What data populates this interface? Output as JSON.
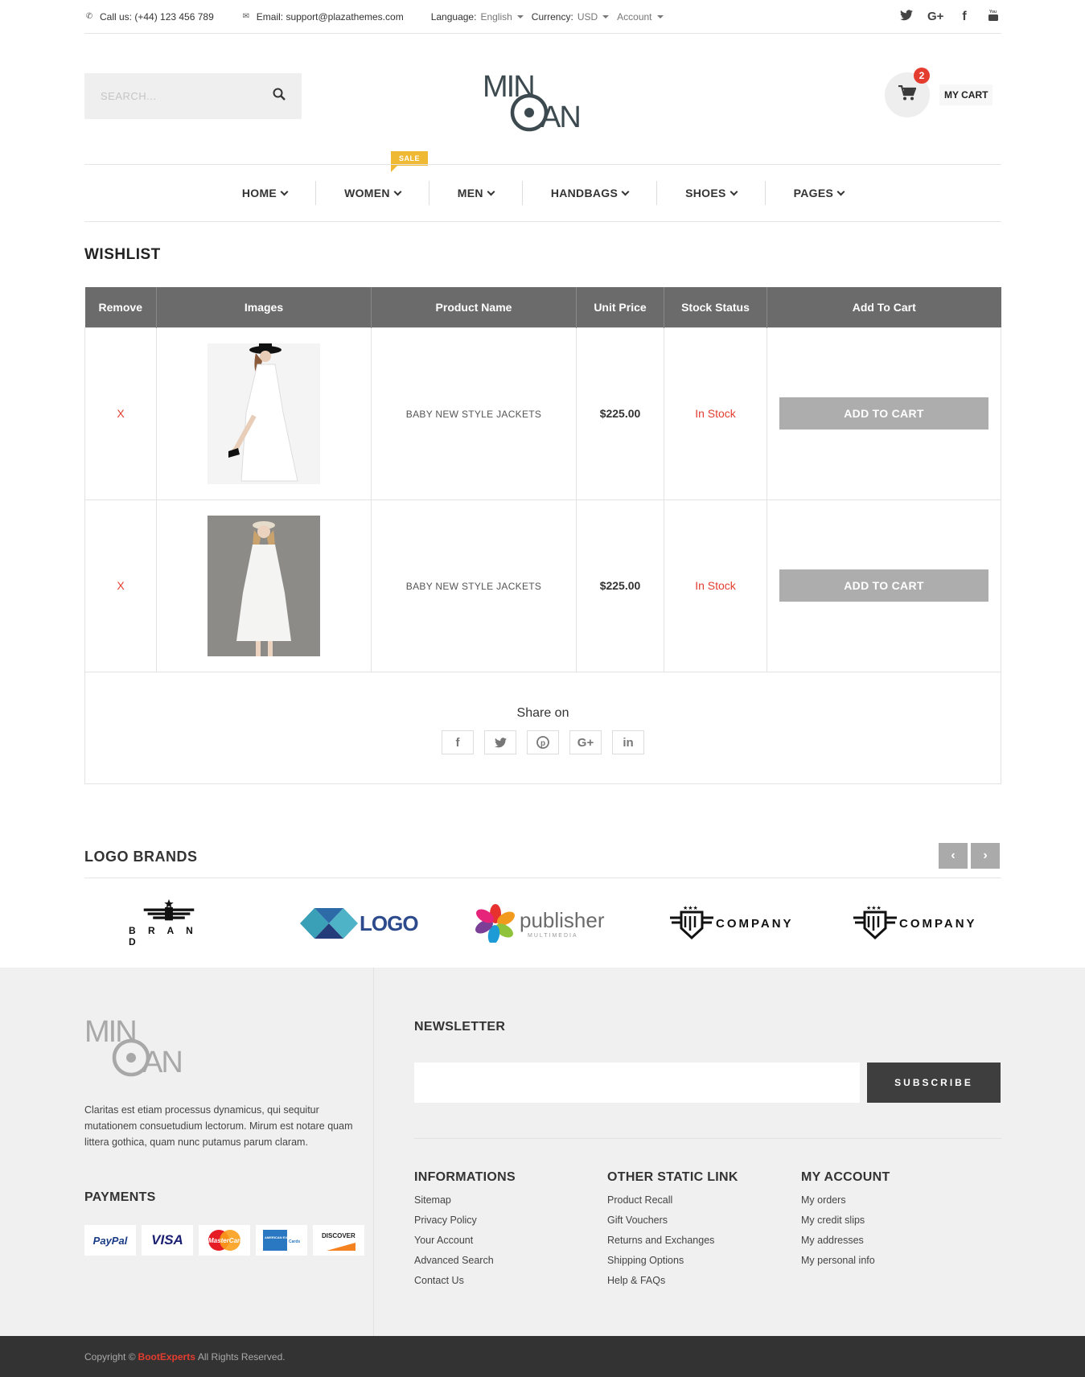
{
  "topbar": {
    "phone": "Call us: (+44) 123 456 789",
    "email": "Email: support@plazathemes.com",
    "language_label": "Language:",
    "language_value": "English",
    "currency_label": "Currency:",
    "currency_value": "USD",
    "account": "Account",
    "social": [
      "twitter-icon",
      "google-plus-icon",
      "facebook-icon",
      "youtube-icon"
    ]
  },
  "header": {
    "search_placeholder": "SEARCH...",
    "logo_top": "MIN",
    "logo_bottom": "AN",
    "cart_count": "2",
    "cart_label": "MY CART"
  },
  "nav": {
    "items": [
      {
        "label": "HOME"
      },
      {
        "label": "WOMEN"
      },
      {
        "label": "MEN"
      },
      {
        "label": "HANDBAGS"
      },
      {
        "label": "SHOES"
      },
      {
        "label": "PAGES"
      }
    ],
    "sale_badge": "SALE"
  },
  "wishlist": {
    "title": "WISHLIST",
    "columns": [
      "Remove",
      "Images",
      "Product Name",
      "Unit Price",
      "Stock Status",
      "Add To Cart"
    ],
    "rows": [
      {
        "remove": "X",
        "name": "BABY NEW STYLE JACKETS",
        "price": "$225.00",
        "stock": "In Stock",
        "button": "ADD TO CART"
      },
      {
        "remove": "X",
        "name": "BABY NEW STYLE JACKETS",
        "price": "$225.00",
        "stock": "In Stock",
        "button": "ADD TO CART"
      }
    ],
    "share_title": "Share on",
    "share_icons": [
      "facebook-icon",
      "twitter-icon",
      "pinterest-icon",
      "google-plus-icon",
      "linkedin-icon"
    ]
  },
  "brands": {
    "title": "LOGO BRANDS",
    "items": [
      {
        "text": "B R A N D"
      },
      {
        "text": "LOGO"
      },
      {
        "text": "publisher",
        "sub": "MULTIMEDIA"
      },
      {
        "text": "COMPANY"
      },
      {
        "text": "COMPANY"
      }
    ]
  },
  "footer": {
    "description": "Claritas est etiam processus dynamicus, qui sequitur mutationem consuetudium lectorum. Mirum est notare quam littera gothica, quam nunc putamus parum claram.",
    "payments_title": "PAYMENTS",
    "payments": [
      "PayPal",
      "VISA",
      "MasterCard",
      "AMERICAN EXPRESS",
      "DISCOVER"
    ],
    "newsletter_title": "NEWSLETTER",
    "subscribe": "SUBSCRIBE",
    "col1_title": "INFORMATIONS",
    "col1": [
      "Sitemap",
      "Privacy Policy",
      "Your Account",
      "Advanced Search",
      "Contact Us"
    ],
    "col2_title": "OTHER STATIC LINK",
    "col2": [
      "Product Recall",
      "Gift Vouchers",
      "Returns and Exchanges",
      "Shipping Options",
      "Help & FAQs"
    ],
    "col3_title": "MY ACCOUNT",
    "col3": [
      "My orders",
      "My credit slips",
      "My addresses",
      "My personal info"
    ],
    "copyright_pre": "Copyright ©",
    "copyright_brand": "BootExperts",
    "copyright_post": "All Rights Reserved."
  },
  "colors": {
    "accent_red": "#e43d30",
    "sale_yellow": "#f0b934",
    "table_header": "#6b6b6b",
    "footer_bg": "#f0f0f0",
    "bottom_bar": "#333333"
  }
}
